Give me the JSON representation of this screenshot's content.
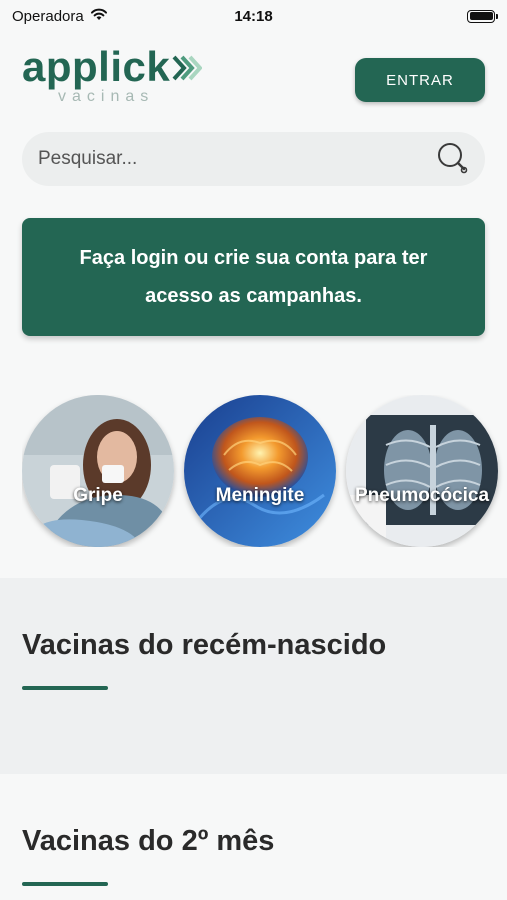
{
  "status_bar": {
    "carrier": "Operadora",
    "time": "14:18"
  },
  "header": {
    "logo_text": "applick",
    "logo_subtext": "vacinas",
    "login_label": "ENTRAR"
  },
  "search": {
    "placeholder": "Pesquisar..."
  },
  "banner": {
    "text": "Faça login ou crie sua conta para ter acesso as campanhas."
  },
  "categories": [
    {
      "label": "Gripe"
    },
    {
      "label": "Meningite"
    },
    {
      "label": "Pneumocócica"
    }
  ],
  "sections": [
    {
      "title": "Vacinas do recém-nascido"
    },
    {
      "title": "Vacinas do 2º mês"
    }
  ],
  "colors": {
    "brand": "#236653",
    "background": "#f7f8f8",
    "section_alt": "#eef0f1"
  }
}
